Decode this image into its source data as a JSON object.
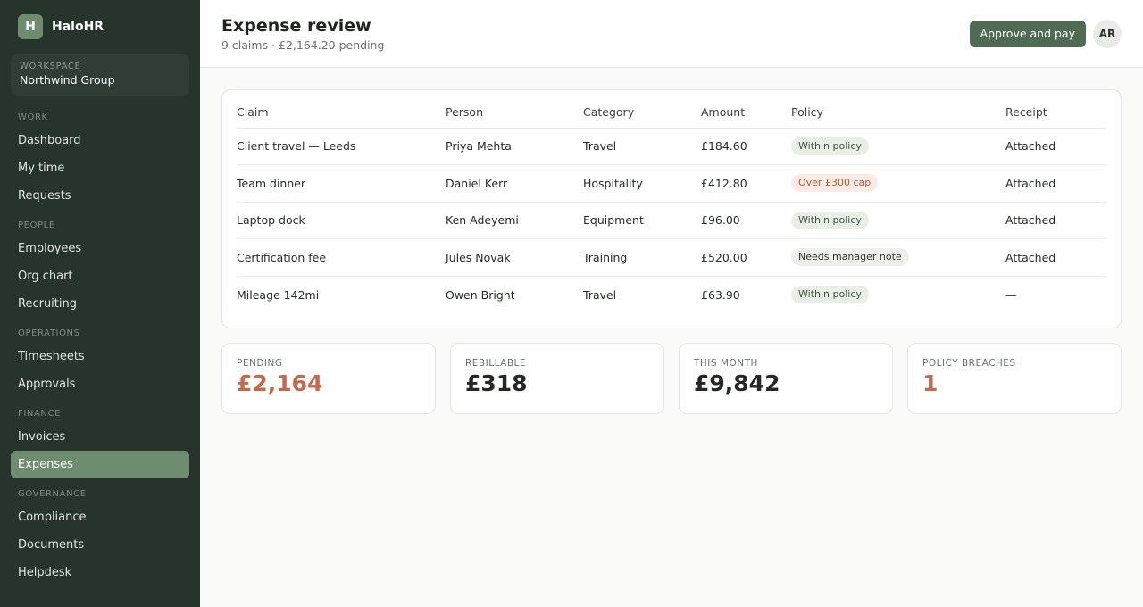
{
  "brand": {
    "initial": "H",
    "name": "HaloHR"
  },
  "workspace": {
    "label": "WORKSPACE",
    "name": "Northwind Group"
  },
  "nav": [
    {
      "heading": "WORK",
      "items": [
        "Dashboard",
        "My time",
        "Requests"
      ]
    },
    {
      "heading": "PEOPLE",
      "items": [
        "Employees",
        "Org chart",
        "Recruiting"
      ]
    },
    {
      "heading": "OPERATIONS",
      "items": [
        "Timesheets",
        "Approvals"
      ]
    },
    {
      "heading": "FINANCE",
      "items": [
        "Invoices",
        "Expenses"
      ]
    },
    {
      "heading": "GOVERNANCE",
      "items": [
        "Compliance",
        "Documents",
        "Helpdesk"
      ]
    }
  ],
  "active_nav": "Expenses",
  "header": {
    "title": "Expense review",
    "subtitle": "9 claims · £2,164.20 pending",
    "primary_action": "Approve and pay",
    "avatar_initials": "AR"
  },
  "table": {
    "columns": [
      "Claim",
      "Person",
      "Category",
      "Amount",
      "Policy",
      "Receipt"
    ],
    "rows": [
      {
        "claim": "Client travel — Leeds",
        "person": "Priya Mehta",
        "category": "Travel",
        "amount": "£184.60",
        "policy": "Within policy",
        "policy_status": "ok",
        "receipt": "Attached"
      },
      {
        "claim": "Team dinner",
        "person": "Daniel Kerr",
        "category": "Hospitality",
        "amount": "£412.80",
        "policy": "Over £300 cap",
        "policy_status": "bad",
        "receipt": "Attached"
      },
      {
        "claim": "Laptop dock",
        "person": "Ken Adeyemi",
        "category": "Equipment",
        "amount": "£96.00",
        "policy": "Within policy",
        "policy_status": "ok",
        "receipt": "Attached"
      },
      {
        "claim": "Certification fee",
        "person": "Jules Novak",
        "category": "Training",
        "amount": "£520.00",
        "policy": "Needs manager note",
        "policy_status": "note",
        "receipt": "Attached"
      },
      {
        "claim": "Mileage 142mi",
        "person": "Owen Bright",
        "category": "Travel",
        "amount": "£63.90",
        "policy": "Within policy",
        "policy_status": "ok",
        "receipt": "—"
      }
    ]
  },
  "stats": [
    {
      "label": "PENDING",
      "value": "£2,164",
      "alert": true
    },
    {
      "label": "REBILLABLE",
      "value": "£318",
      "alert": false
    },
    {
      "label": "THIS MONTH",
      "value": "£9,842",
      "alert": false
    },
    {
      "label": "POLICY BREACHES",
      "value": "1",
      "alert": true
    }
  ],
  "colors": {
    "sidebar_bg": "#26342b",
    "accent": "#6e8d70",
    "primary_button": "#4f6b53",
    "alert": "#c46a4c"
  }
}
